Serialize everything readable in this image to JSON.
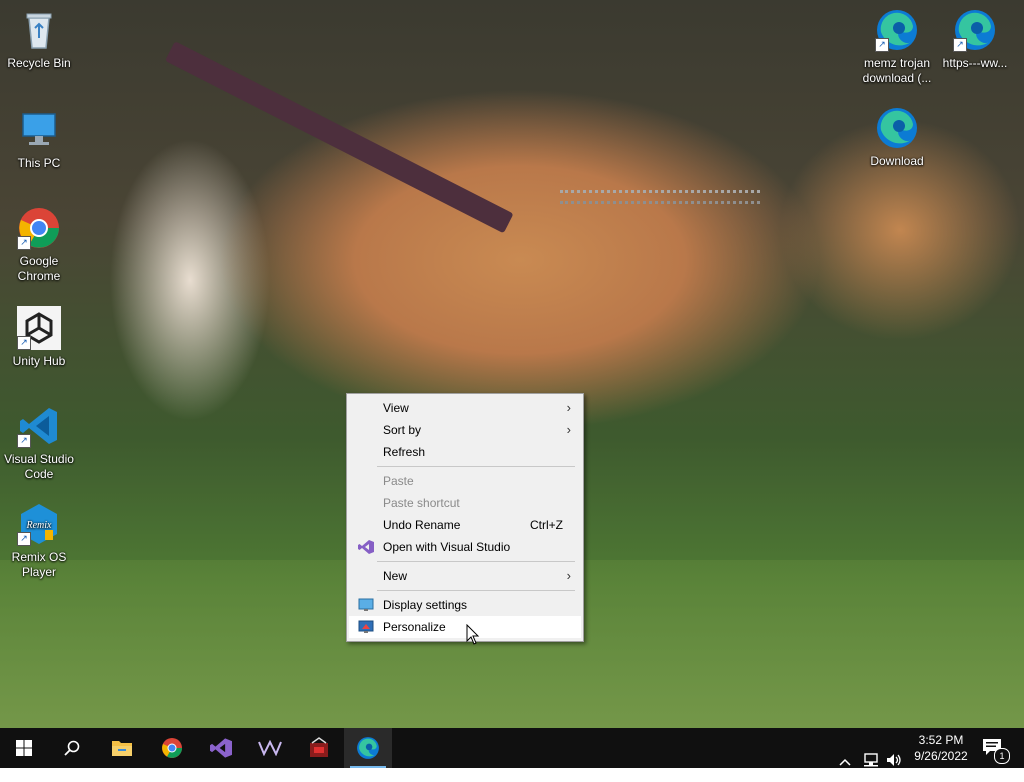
{
  "desktop_icons": {
    "recycle_bin": "Recycle Bin",
    "this_pc": "This PC",
    "chrome": "Google Chrome",
    "unity_hub": "Unity Hub",
    "vscode": "Visual Studio Code",
    "remix_os": "Remix OS Player",
    "memz": "memz trojan download (...",
    "https": "https---ww...",
    "download": "Download"
  },
  "context_menu": {
    "view": "View",
    "sort_by": "Sort by",
    "refresh": "Refresh",
    "paste": "Paste",
    "paste_shortcut": "Paste shortcut",
    "undo_rename": "Undo Rename",
    "undo_rename_shortcut": "Ctrl+Z",
    "open_with_vs": "Open with Visual Studio",
    "new": "New",
    "display_settings": "Display settings",
    "personalize": "Personalize"
  },
  "taskbar": {
    "time": "3:52 PM",
    "date": "9/26/2022",
    "notification_count": "1"
  },
  "colors": {
    "taskbar_bg": "#101010",
    "menu_bg": "#f0f0f0",
    "accent": "#76b9ed"
  }
}
